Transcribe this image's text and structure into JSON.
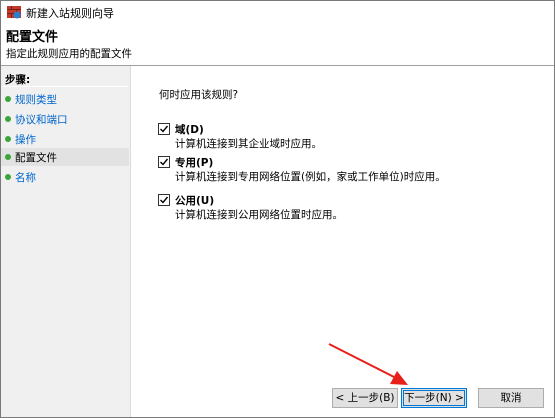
{
  "window": {
    "title": "新建入站规则向导"
  },
  "header": {
    "title": "配置文件",
    "subtitle": "指定此规则应用的配置文件"
  },
  "sidebar": {
    "steps_label": "步骤:",
    "items": [
      {
        "label": "规则类型"
      },
      {
        "label": "协议和端口"
      },
      {
        "label": "操作"
      },
      {
        "label": "配置文件",
        "active": true
      },
      {
        "label": "名称"
      }
    ]
  },
  "main": {
    "question": "何时应用该规则?",
    "options": [
      {
        "name": "域(D)",
        "description": "计算机连接到其企业域时应用。",
        "checked": true
      },
      {
        "name": "专用(P)",
        "description": "计算机连接到专用网络位置(例如，家或工作单位)时应用。",
        "checked": true
      },
      {
        "name": "公用(U)",
        "description": "计算机连接到公用网络位置时应用。",
        "checked": true
      }
    ]
  },
  "buttons": {
    "back": "< 上一步(B)",
    "next": "下一步(N) >",
    "cancel": "取消"
  },
  "colors": {
    "accent": "#0078d7",
    "link": "#0066cc",
    "step_dot": "#3aa63a",
    "annotation_arrow": "#e8201a"
  },
  "icons": {
    "window": "firewall-icon",
    "step_bullet": "green-dot-icon",
    "check": "checkmark-icon"
  }
}
